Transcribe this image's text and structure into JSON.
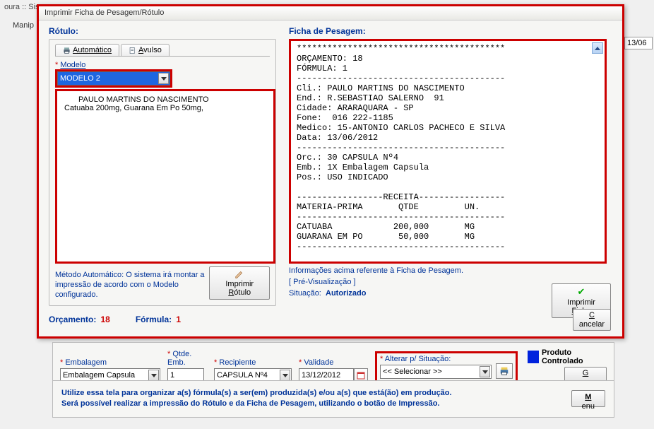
{
  "bg": {
    "title_fragment": "oura :: Sis",
    "menu_item": "Manip",
    "date_fragment": "13/06"
  },
  "dialog": {
    "title": "Imprimir Ficha de Pesagem/Rótulo",
    "rotulo_label": "Rótulo:",
    "ficha_label": "Ficha de Pesagem:",
    "tabs": {
      "auto": "Automático",
      "avulso": "Avulso"
    },
    "modelo_label": "Modelo",
    "modelo_value": "MODELO 2",
    "preview": {
      "line1": "PAULO MARTINS DO NASCIMENTO",
      "line2": "Catuaba 200mg, Guarana Em Po 50mg,"
    },
    "hint": "Método Automático: O sistema irá montar a impressão de acordo com o Modelo configurado.",
    "imprimir_rotulo": "Imprimir Rótulo",
    "ficha_text": "*****************************************\nORÇAMENTO: 18\nFÓRMULA: 1\n-----------------------------------------\nCli.: PAULO MARTINS DO NASCIMENTO\nEnd.: R.SEBASTIAO SALERNO  91\nCidade: ARARAQUARA - SP\nFone:  016 222-1185\nMedico: 15-ANTONIO CARLOS PACHECO E SILVA\nData: 13/06/2012\n-----------------------------------------\nOrc.: 30 CAPSULA Nº4\nEmb.: 1X Embalagem Capsula\nPos.: USO INDICADO\n\n-----------------RECEITA-----------------\nMATERIA-PRIMA       QTDE         UN.\n-----------------------------------------\nCATUABA            200,000       MG\nGUARANA EM PO       50,000       MG\n-----------------------------------------",
    "info1": "Informações acima referente à Ficha de Pesagem.",
    "info2": "[ Pré-Visualização ]",
    "situacao_label": "Situação:",
    "situacao_value": "Autorizado",
    "imprimir_ficha": "Imprimir Ficha",
    "orc_label": "Orçamento:",
    "orc_value": "18",
    "formula_label": "Fórmula:",
    "formula_value": "1",
    "cancelar": "Cancelar"
  },
  "bottom": {
    "embalagem_label": "Embalagem",
    "embalagem_value": "Embalagem Capsula",
    "qtde_label": "Qtde. Emb.",
    "qtde_value": "1",
    "recipiente_label": "Recipiente",
    "recipiente_value": "CAPSULA Nº4",
    "validade_label": "Validade",
    "validade_value": "13/12/2012",
    "situacao_label": "Alterar p/ Situação:",
    "situacao_value": "<< Selecionar >>",
    "produto_controlado": "Produto Controlado",
    "gravar": "Gravar"
  },
  "info": {
    "line1": "Utilize essa tela para organizar a(s) fórmula(s) a ser(em) produzida(s) e/ou a(s) que está(ão) em produção.",
    "line2": "Será possível realizar a impressão do Rótulo e da Ficha de Pesagem, utilizando o botão de Impressão.",
    "menu": "Menu"
  }
}
